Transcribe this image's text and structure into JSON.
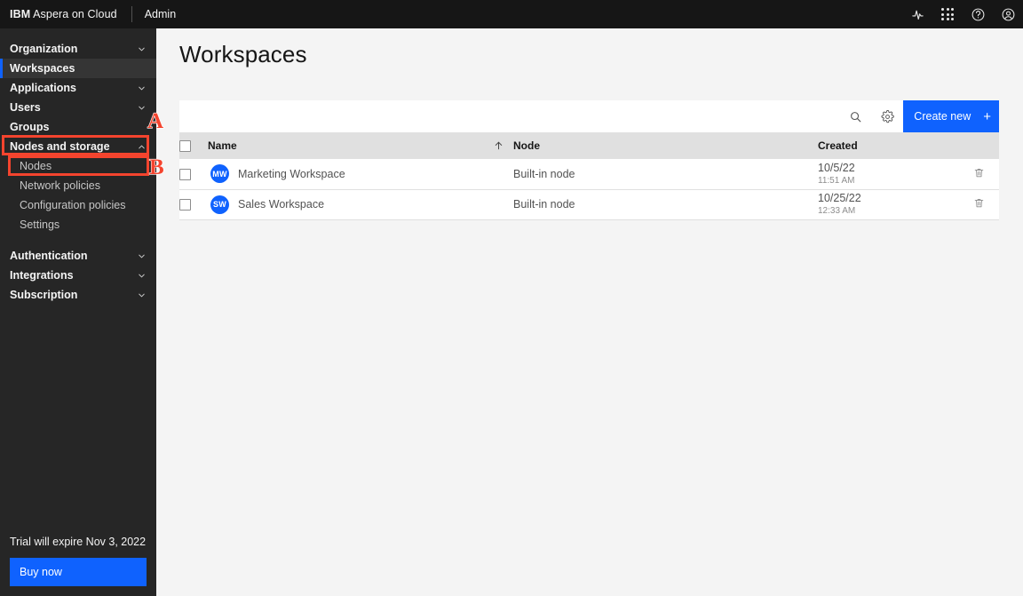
{
  "header": {
    "brand_bold": "IBM",
    "brand_rest": " Aspera on Cloud",
    "section": "Admin",
    "icons": {
      "activity": "activity-icon",
      "app_switcher": "app-switcher-grid-icon",
      "help": "help-question-icon",
      "account": "user-avatar-icon"
    }
  },
  "sidebar": {
    "items": [
      {
        "label": "Organization",
        "type": "group",
        "expandable": true,
        "expanded": false,
        "selected": false
      },
      {
        "label": "Workspaces",
        "type": "group",
        "expandable": false,
        "expanded": false,
        "selected": true
      },
      {
        "label": "Applications",
        "type": "group",
        "expandable": true,
        "expanded": false,
        "selected": false
      },
      {
        "label": "Users",
        "type": "group",
        "expandable": true,
        "expanded": false,
        "selected": false
      },
      {
        "label": "Groups",
        "type": "group",
        "expandable": false,
        "expanded": false,
        "selected": false
      },
      {
        "label": "Nodes and storage",
        "type": "group",
        "expandable": true,
        "expanded": true,
        "selected": false
      },
      {
        "label": "Nodes",
        "type": "sub"
      },
      {
        "label": "Network policies",
        "type": "sub"
      },
      {
        "label": "Configuration policies",
        "type": "sub"
      },
      {
        "label": "Settings",
        "type": "sub"
      },
      {
        "label": "Authentication",
        "type": "group",
        "expandable": true,
        "expanded": false,
        "selected": false
      },
      {
        "label": "Integrations",
        "type": "group",
        "expandable": true,
        "expanded": false,
        "selected": false
      },
      {
        "label": "Subscription",
        "type": "group",
        "expandable": true,
        "expanded": false,
        "selected": false
      }
    ],
    "trial_text": "Trial will expire Nov 3, 2022",
    "buy_label": "Buy now"
  },
  "main": {
    "title": "Workspaces",
    "toolbar": {
      "search_icon": "search-icon",
      "settings_icon": "gear-icon",
      "create_label": "Create new",
      "create_plus": "+"
    },
    "table": {
      "columns": [
        "Name",
        "Node",
        "Created"
      ],
      "sort_column": "Name",
      "sort_direction": "ascending",
      "rows": [
        {
          "initials": "MW",
          "name": "Marketing Workspace",
          "node": "Built-in node",
          "created_date": "10/5/22",
          "created_time": "11:51 AM",
          "delete_icon": "trash-icon"
        },
        {
          "initials": "SW",
          "name": "Sales Workspace",
          "node": "Built-in node",
          "created_date": "10/25/22",
          "created_time": "12:33 AM",
          "delete_icon": "trash-icon"
        }
      ]
    }
  },
  "annotations": [
    {
      "letter": "A",
      "target": "Nodes and storage"
    },
    {
      "letter": "B",
      "target": "Nodes"
    }
  ],
  "colors": {
    "accent_blue": "#0f62fe",
    "annotation_red": "#f4442e",
    "header_black": "#161616",
    "sidebar_dark": "#262626"
  }
}
